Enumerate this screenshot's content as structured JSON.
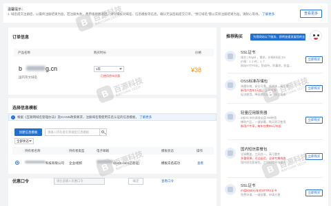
{
  "tip": {
    "title": "温馨提示：",
    "text": "1. 域名提交注册后，以最终注册结果为准，若注册失败，费用将原路退回，请仔细核对域名、信息模板等信息，确认无误后再提交订单。“预订域名”需以实际注册结果为准，请耐心等待。",
    "more_link": "了解更多",
    "button": "查看更多"
  },
  "order": {
    "title": "订单信息",
    "columns": [
      "产品名称",
      "购买时长",
      "价格"
    ],
    "domain_prefix": "b",
    "domain_suffix": "g.cn",
    "domain_type": "国内英文域名",
    "duration": "1年",
    "duration_note": "已使用首年优惠",
    "price": "¥38"
  },
  "info": {
    "title": "选择信息模板",
    "notice": "根据《互联网域名管理办法》及ICANN政策要求，注册域名需使用实名认证的信息模板，",
    "notice_link": "了解更多",
    "create_button": "创建信息模板",
    "search_placeholder": "请输入持有者名称搜索信息模板",
    "filter": "全部状态",
    "columns": [
      "持有者名称",
      "持有者类型",
      "电子邮箱",
      "模板状态",
      "操作"
    ],
    "row": {
      "owner_suffix": "科技有限公司",
      "type": "企业/组织",
      "email": "@163.com(已验证)",
      "status": "模板实名成功",
      "action": "查看"
    }
  },
  "promo": {
    "title": "优惠口令",
    "placeholder": "请在此输入优惠口令",
    "button": "确定",
    "link": "查看口令"
  },
  "side": {
    "title": "推荐购买",
    "banner": "为您网站以下服务，即将加速发展您的业务",
    "buy_label": "立即购买",
    "products": [
      {
        "name": "SSL证书",
        "lines": [
          "域名 | Rapid ，需求，价格8折起 DV",
          "价格：1 小时，1 个",
          "网站HTTPS化，防劫持，防篡改，防监..."
        ],
        "red": [
          false,
          false,
          false
        ]
      },
      {
        "name": "OSS标准存储包",
        "lines": [
          "海量存储，安全可靠，低成本，高可靠",
          "新用户首年1元起，上不封顶！",
          "促进使用，降低使用成本最高达折扣"
        ],
        "red": [
          false,
          true,
          false
        ]
      },
      {
        "name": "轻量应用服务器",
        "lines": [
          "2核2G 50G高效云盘 5M带宽",
          "爆款产品，一键部署，购买即可使用",
          "新用户专享，每年仅需99元/年起"
        ],
        "red": [
          false,
          false,
          true
        ]
      },
      {
        "name": "国内短信套餐包",
        "lines": [
          "全球覆盖，三网合一，高可靠性",
          "多重保障，可达延迟，全球专属线路",
          "国内短信套餐包，三网短信平均延迟"
        ],
        "red": [
          false,
          true,
          false
        ]
      },
      {
        "name": "SSL证书",
        "lines": [
          "价值5000元/年的HTTPS证书",
          "免费申请，一键部署，申请方便"
        ],
        "red": [
          true,
          false
        ]
      }
    ]
  },
  "watermark": {
    "logo": "B",
    "text": "百源科技",
    "sub": "BAIYUAN TECH"
  },
  "colors": {
    "accent": "#1f6fd1",
    "price": "#ff8a00",
    "warn": "#e4393c"
  }
}
